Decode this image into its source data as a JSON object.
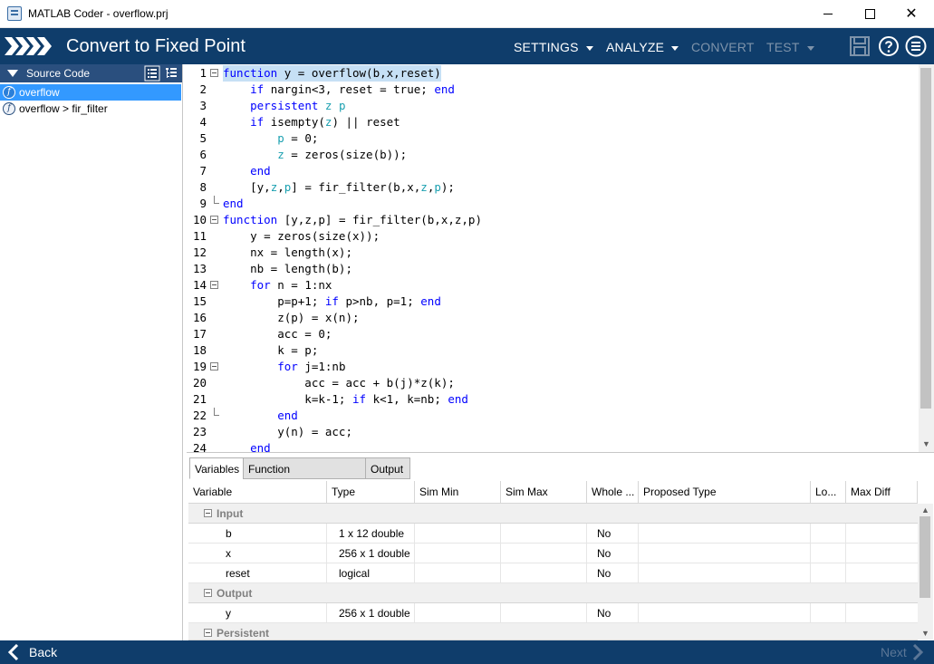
{
  "window": {
    "title": "MATLAB Coder - overflow.prj"
  },
  "appbar": {
    "title": "Convert to Fixed Point",
    "menu": {
      "settings": "SETTINGS",
      "analyze": "ANALYZE",
      "convert": "CONVERT",
      "test": "TEST"
    }
  },
  "source_panel": {
    "title": "Source Code",
    "items": [
      {
        "label": "overflow"
      },
      {
        "label": "overflow > fir_filter"
      }
    ]
  },
  "editor": {
    "line_numbers": [
      "1",
      "2",
      "3",
      "4",
      "5",
      "6",
      "7",
      "8",
      "9",
      "10",
      "11",
      "12",
      "13",
      "14",
      "15",
      "16",
      "17",
      "18",
      "19",
      "20",
      "21",
      "22",
      "23",
      "24"
    ]
  },
  "tabs": {
    "variables": "Variables",
    "function_replacements": "Function Replacements",
    "output": "Output"
  },
  "grid": {
    "columns": [
      "Variable",
      "Type",
      "Sim Min",
      "Sim Max",
      "Whole ...",
      "Proposed Type",
      "Lo...",
      "Max Diff"
    ],
    "groups": {
      "input": "Input",
      "output": "Output",
      "persistent": "Persistent"
    },
    "rows": [
      {
        "variable": "b",
        "type": "1 x 12 double",
        "whole": "No"
      },
      {
        "variable": "x",
        "type": "256 x 1 double",
        "whole": "No"
      },
      {
        "variable": "reset",
        "type": "logical",
        "whole": "No"
      },
      {
        "variable": "y",
        "type": "256 x 1 double",
        "whole": "No"
      }
    ]
  },
  "footer": {
    "back": "Back",
    "next": "Next"
  },
  "colors": {
    "header_bg": "#0f3d6b",
    "selection": "#3399ff",
    "keyword": "#0000ff",
    "persistent_var": "#1aa0b0"
  }
}
